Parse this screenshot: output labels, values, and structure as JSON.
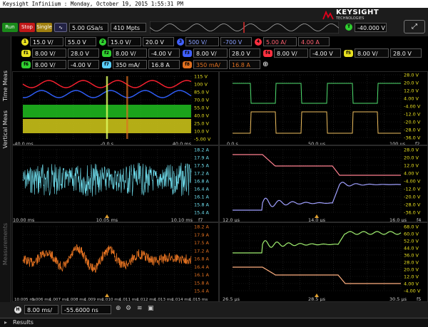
{
  "title": "Keysight Infiniium : Monday, October 19, 2015 1:55:31 PM",
  "brand": {
    "name": "KEYSIGHT",
    "sub": "TECHNOLOGIES",
    "color": "#e0001b"
  },
  "top": {
    "run": "Run",
    "stop": "Stop",
    "single": "Single",
    "sample_rate": "5.00 GSa/s",
    "memory": "410 Mpts",
    "trigger_level": "-40.000 V",
    "trigger_label": "T"
  },
  "channels_row1": [
    {
      "num": "1",
      "tag": "1MΩ",
      "scale": "15.0 V/",
      "offset": "55.0 V",
      "color": "#e8e020"
    },
    {
      "num": "2",
      "tag": "1MΩ",
      "scale": "15.0 V/",
      "offset": "20.0 V",
      "color": "#30d030"
    },
    {
      "num": "3",
      "tag": "1MΩ",
      "scale": "500 V/",
      "offset": "-700 V",
      "color": "#4060ff"
    },
    {
      "num": "4",
      "tag": "1MΩ",
      "scale": "5.00 A/",
      "offset": "4.00 A",
      "color": "#ff3040"
    }
  ],
  "functions_row2": [
    {
      "num": "f1",
      "scale": "8.00 V/",
      "offset": "28.0 V",
      "color": "#e8e020"
    },
    {
      "num": "f2",
      "scale": "8.00 V/",
      "offset": "-4.00 V",
      "color": "#30d030"
    },
    {
      "num": "f3",
      "scale": "8.00 V/",
      "offset": "28.0 V",
      "color": "#4060ff"
    },
    {
      "num": "f4",
      "scale": "8.00 V/",
      "offset": "-4.00 V",
      "color": "#ff3040"
    },
    {
      "num": "f5",
      "scale": "8.00 V/",
      "offset": "28.0 V",
      "color": "#e8e020"
    }
  ],
  "functions_row3": [
    {
      "num": "f6",
      "scale": "8.00 V/",
      "offset": "-4.00 V",
      "color": "#30d030"
    },
    {
      "num": "f7",
      "scale": "350 mA/",
      "offset": "16.8 A",
      "color": "#5ad0ff"
    },
    {
      "num": "f8",
      "scale": "350 mA/",
      "offset": "16.8 A",
      "color": "#e07020"
    }
  ],
  "sidebar": {
    "time_meas": "Time Meas",
    "vertical_meas": "Vertical Meas",
    "measurements": "Measurements"
  },
  "panel_main": {
    "scale": [
      "115 V",
      "100 V",
      "85.0 V",
      "70.0 V",
      "55.0 V",
      "40.0 V",
      "25.0 V",
      "10.0 V",
      "-5.00 V"
    ],
    "x_left": "-40.0 ms",
    "x_mid": "-0.0 s",
    "x_right": "40.0 ms"
  },
  "panel_zoom1": {
    "scale": [
      "18.2 A",
      "17.9 A",
      "17.5 A",
      "17.2 A",
      "16.8 A",
      "16.4 A",
      "16.1 A",
      "15.8 A",
      "15.4 A"
    ],
    "x_left": "10.00 ms",
    "x_mid": "10.05 ms",
    "x_right": "10.10 ms",
    "fn": "f7"
  },
  "panel_zoom2": {
    "scale": [
      "18.2 A",
      "17.9 A",
      "17.5 A",
      "17.2 A",
      "16.8 A",
      "16.4 A",
      "16.1 A",
      "15.8 A",
      "15.4 A"
    ],
    "x_labels": [
      "10.005 ms",
      "1.006 ms",
      "1.007 ms",
      "1.008 ms",
      "1.009 ms",
      "1.010 ms",
      "1.011 ms",
      "1.012 ms",
      "1.013 ms",
      "1.014 ms",
      "1.015 ms"
    ],
    "fn": "f8"
  },
  "panel_r1": {
    "scale": [
      "28.0 V",
      "20.0 V",
      "12.0 V",
      "4.00 V",
      "-4.00 V",
      "-12.0 V",
      "-20.0 V",
      "-28.0 V",
      "-36.0 V"
    ],
    "x_left": "0.0 s",
    "x_mid": "50.0 µs",
    "x_right": "100 µs",
    "fn": "f2"
  },
  "panel_r2": {
    "scale": [
      "28.0 V",
      "20.0 V",
      "12.0 V",
      "4.00 V",
      "-4.00 V",
      "-12.0 V",
      "-20.0 V",
      "-28.0 V",
      "-36.0 V"
    ],
    "x_left": "12.0 µs",
    "x_mid": "14.0 µs",
    "x_right": "16.0 µs",
    "fn": "f4"
  },
  "panel_r3": {
    "scale": [
      "68.0 V",
      "60.0 V",
      "52.0 V",
      "44.0 V",
      "36.0 V",
      "28.0 V",
      "20.0 V",
      "12.0 V",
      "4.00 V",
      "-4.00 V"
    ],
    "x_left": "26.5 µs",
    "x_mid": "28.5 µs",
    "x_right": "30.5 µs",
    "fn": "f5"
  },
  "bottom": {
    "h_label": "H",
    "h_scale": "8.00 ms/",
    "h_position": "-55.6000 ns"
  },
  "results": {
    "label": "Results"
  }
}
